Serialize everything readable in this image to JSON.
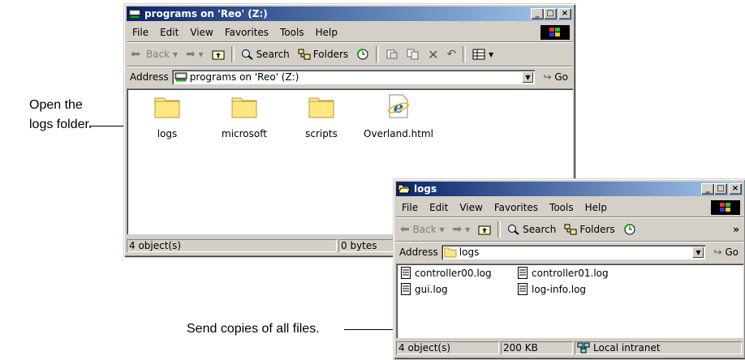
{
  "callouts": {
    "open_line1": "Open the",
    "open_line2": "logs folder.",
    "send": "Send copies of all files."
  },
  "window_main": {
    "title": "programs on 'Reo' (Z:)",
    "menu": [
      "File",
      "Edit",
      "View",
      "Favorites",
      "Tools",
      "Help"
    ],
    "toolbar": {
      "back": "Back",
      "search": "Search",
      "folders": "Folders"
    },
    "address_label": "Address",
    "address_value": "programs on 'Reo' (Z:)",
    "go": "Go",
    "items": [
      {
        "label": "logs",
        "icon": "folder-icon"
      },
      {
        "label": "microsoft",
        "icon": "folder-icon"
      },
      {
        "label": "scripts",
        "icon": "folder-icon"
      },
      {
        "label": "Overland.html",
        "icon": "ie-html-icon"
      }
    ],
    "status": {
      "count": "4 object(s)",
      "size": "0 bytes"
    }
  },
  "window_logs": {
    "title": "logs",
    "menu": [
      "File",
      "Edit",
      "View",
      "Favorites",
      "Tools",
      "Help"
    ],
    "toolbar": {
      "back": "Back",
      "search": "Search",
      "folders": "Folders",
      "more": "»"
    },
    "address_label": "Address",
    "address_value": "logs",
    "go": "Go",
    "files": [
      "controller00.log",
      "controller01.log",
      "gui.log",
      "log-info.log"
    ],
    "status": {
      "count": "4 object(s)",
      "size": "200 KB",
      "zone": "Local intranet"
    }
  },
  "colors": {
    "titlebar_start": "#0a246a",
    "titlebar_end": "#a6caf0",
    "face": "#d4d0c8"
  }
}
